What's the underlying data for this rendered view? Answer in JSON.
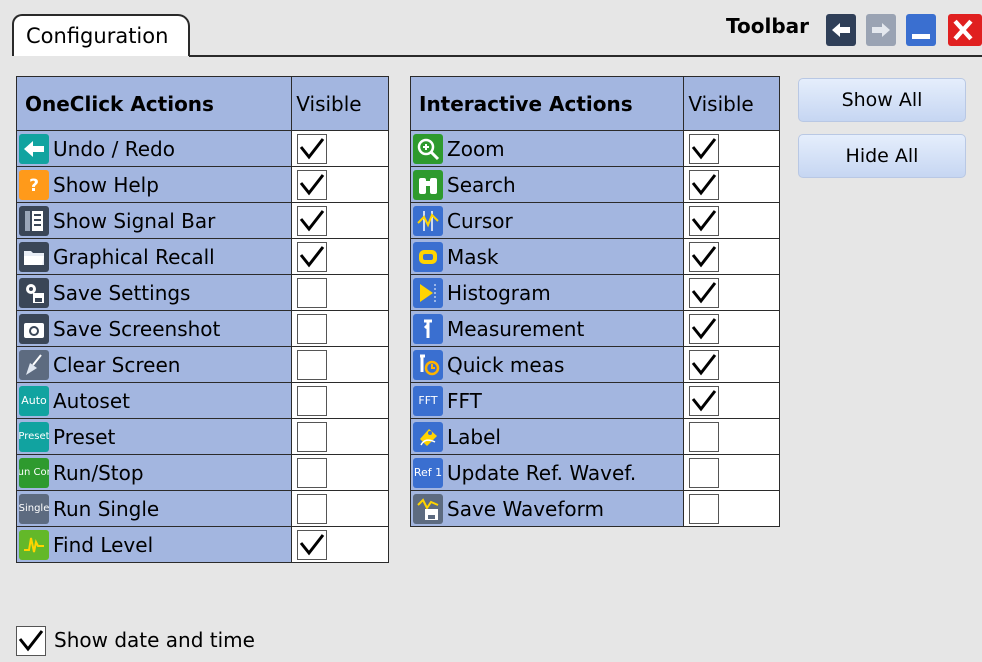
{
  "tab": {
    "label": "Configuration"
  },
  "toolbar": {
    "label": "Toolbar"
  },
  "oneclick": {
    "header": "OneClick Actions",
    "visible_header": "Visible",
    "items": [
      {
        "label": "Undo / Redo",
        "icon": "undo-icon",
        "visible": true
      },
      {
        "label": "Show Help",
        "icon": "help-icon",
        "visible": true
      },
      {
        "label": "Show Signal Bar",
        "icon": "signal-bar-icon",
        "visible": true
      },
      {
        "label": "Graphical Recall",
        "icon": "folder-icon",
        "visible": true
      },
      {
        "label": "Save Settings",
        "icon": "save-settings-icon",
        "visible": false
      },
      {
        "label": "Save Screenshot",
        "icon": "camera-icon",
        "visible": false
      },
      {
        "label": "Clear Screen",
        "icon": "broom-icon",
        "visible": false
      },
      {
        "label": "Autoset",
        "icon": "autoset-icon",
        "icon_text": "Auto",
        "visible": false
      },
      {
        "label": "Preset",
        "icon": "preset-icon",
        "icon_text": "Preset",
        "visible": false
      },
      {
        "label": "Run/Stop",
        "icon": "run-stop-icon",
        "icon_text": "Run Cont",
        "visible": false
      },
      {
        "label": "Run Single",
        "icon": "run-single-icon",
        "icon_text": "Single",
        "visible": false
      },
      {
        "label": "Find Level",
        "icon": "find-level-icon",
        "visible": true
      }
    ]
  },
  "interactive": {
    "header": "Interactive Actions",
    "visible_header": "Visible",
    "items": [
      {
        "label": "Zoom",
        "icon": "zoom-icon",
        "visible": true
      },
      {
        "label": "Search",
        "icon": "binoculars-icon",
        "visible": true
      },
      {
        "label": "Cursor",
        "icon": "cursor-icon",
        "visible": true
      },
      {
        "label": "Mask",
        "icon": "mask-icon",
        "visible": true
      },
      {
        "label": "Histogram",
        "icon": "histogram-icon",
        "visible": true
      },
      {
        "label": "Measurement",
        "icon": "measurement-icon",
        "visible": true
      },
      {
        "label": "Quick meas",
        "icon": "quick-meas-icon",
        "visible": true
      },
      {
        "label": "FFT",
        "icon": "fft-icon",
        "icon_text": "FFT",
        "visible": true
      },
      {
        "label": "Label",
        "icon": "label-icon",
        "visible": false
      },
      {
        "label": "Update Ref. Wavef.",
        "icon": "update-ref-icon",
        "icon_text": "Ref 1",
        "visible": false
      },
      {
        "label": "Save Waveform",
        "icon": "save-waveform-icon",
        "visible": false
      }
    ]
  },
  "buttons": {
    "show_all": "Show All",
    "hide_all": "Hide All"
  },
  "show_date_time": {
    "label": "Show date and time",
    "checked": true
  },
  "colors": {
    "header_bg": "#a3b6e0",
    "page_bg": "#e6e6e6",
    "button_bg": "#d4e1f6",
    "close_red": "#e02020",
    "toolbar_btn_blue": "#3a6fd0"
  }
}
